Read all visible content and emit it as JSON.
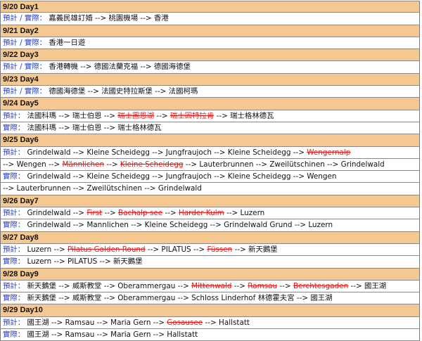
{
  "colors": {
    "header_bg": "#f5c891",
    "label": "#2a40c8",
    "cancelled": "#e11a1a",
    "text": "#111111"
  },
  "rows": [
    {
      "type": "header",
      "text": "9/20 Day1"
    },
    {
      "type": "line",
      "label": "預計 / 實際：",
      "segments": [
        {
          "t": "嘉義民雄訂婚 --> 桃園機場 --> 香港"
        }
      ]
    },
    {
      "type": "header",
      "text": "9/21 Day2"
    },
    {
      "type": "line",
      "label": "預計 / 實際：",
      "segments": [
        {
          "t": "香港一日遊"
        }
      ]
    },
    {
      "type": "header",
      "text": "9/22 Day3"
    },
    {
      "type": "line",
      "label": "預計 / 實際：",
      "segments": [
        {
          "t": "香港轉機 --> 德國法蘭克福 --> 德國海德堡"
        }
      ]
    },
    {
      "type": "header",
      "text": "9/23 Day4"
    },
    {
      "type": "line",
      "label": "預計 / 實際：",
      "segments": [
        {
          "t": "德國海德堡 --> 法國史特拉斯堡 --> 法國柯瑪"
        }
      ]
    },
    {
      "type": "header",
      "text": "9/24 Day5"
    },
    {
      "type": "line",
      "label": "預計：",
      "segments": [
        {
          "t": "法國科瑪 --> 瑞士伯恩 --> "
        },
        {
          "t": "瑞士圖恩湖",
          "x": true
        },
        {
          "t": " --> "
        },
        {
          "t": "瑞士因特拉肯",
          "x": true
        },
        {
          "t": " --> 瑞士格林德瓦"
        }
      ]
    },
    {
      "type": "line",
      "label": "實際：",
      "segments": [
        {
          "t": "法國科瑪 --> 瑞士伯恩 --> 瑞士格林德瓦"
        }
      ]
    },
    {
      "type": "header",
      "text": "9/25 Day6"
    },
    {
      "type": "line",
      "label": "預計：",
      "segments": [
        {
          "t": "Grindelwald --> Kleine Scheidegg --> Jungfraujoch --> Kleine Scheidegg --> "
        },
        {
          "t": "Wengernalp",
          "x": true
        }
      ]
    },
    {
      "type": "line",
      "label": "",
      "segments": [
        {
          "t": "--> Wengen --> "
        },
        {
          "t": "Männlichen",
          "x": true
        },
        {
          "t": " --> "
        },
        {
          "t": "Kleine Scheidegg",
          "x": true
        },
        {
          "t": " --> Lauterbrunnen --> Zweilütschinen --> Grindelwald"
        }
      ]
    },
    {
      "type": "line",
      "label": "實際：",
      "segments": [
        {
          "t": "Grindelwald --> Kleine Scheidegg --> Jungfraujoch --> Kleine Scheidegg --> Wengen"
        }
      ]
    },
    {
      "type": "line",
      "label": "",
      "segments": [
        {
          "t": "--> Lauterbrunnen --> Zweilütschinen --> Grindelwald"
        }
      ]
    },
    {
      "type": "header",
      "text": "9/26 Day7"
    },
    {
      "type": "line",
      "label": "預計：",
      "segments": [
        {
          "t": "Grindelwald --> "
        },
        {
          "t": "First",
          "x": true
        },
        {
          "t": " --> "
        },
        {
          "t": "Bachalp see",
          "x": true
        },
        {
          "t": " --> "
        },
        {
          "t": "Harder Kulm",
          "x": true
        },
        {
          "t": " --> Luzern"
        }
      ]
    },
    {
      "type": "line",
      "label": "實際：",
      "segments": [
        {
          "t": "Grindelwald --> Mannlichen --> Kleine Scheidegg --> Grindelwald Grund --> Luzern"
        }
      ]
    },
    {
      "type": "header",
      "text": "9/27 Day8"
    },
    {
      "type": "line",
      "label": "預計：",
      "segments": [
        {
          "t": "Luzern --> "
        },
        {
          "t": "Pilatus Golden Round",
          "x": true
        },
        {
          "t": " --> PILATUS --> "
        },
        {
          "t": "Füssen",
          "x": true
        },
        {
          "t": " --> 新天鵝堡"
        }
      ]
    },
    {
      "type": "line",
      "label": "實際：",
      "segments": [
        {
          "t": "Luzern --> PILATUS --> 新天鵝堡"
        }
      ]
    },
    {
      "type": "header",
      "text": "9/28 Day9"
    },
    {
      "type": "line",
      "label": "預計：",
      "segments": [
        {
          "t": "新天鵝堡 --> 威斯教堂 --> Oberammergau --> "
        },
        {
          "t": "Mittenwald",
          "x": true
        },
        {
          "t": " --> "
        },
        {
          "t": "Ramsau",
          "x": true
        },
        {
          "t": " --> "
        },
        {
          "t": "Berchtesgaden",
          "x": true
        },
        {
          "t": " --> 國王湖"
        }
      ]
    },
    {
      "type": "line",
      "label": "實際：",
      "segments": [
        {
          "t": "新天鵝堡 --> 威斯教堂 --> Oberammergau --> Schloss Linderhof 林德霍夫宮 --> 國王湖"
        }
      ]
    },
    {
      "type": "header",
      "text": "9/29 Day10"
    },
    {
      "type": "line",
      "label": "預計：",
      "segments": [
        {
          "t": "國王湖 --> Ramsau --> Maria Gern --> "
        },
        {
          "t": "Gosausee",
          "x": true
        },
        {
          "t": " --> Hallstatt"
        }
      ]
    },
    {
      "type": "line",
      "label": "實際：",
      "segments": [
        {
          "t": "國王湖 --> Ramsau --> Maria Gern --> Hallstatt"
        }
      ]
    }
  ]
}
